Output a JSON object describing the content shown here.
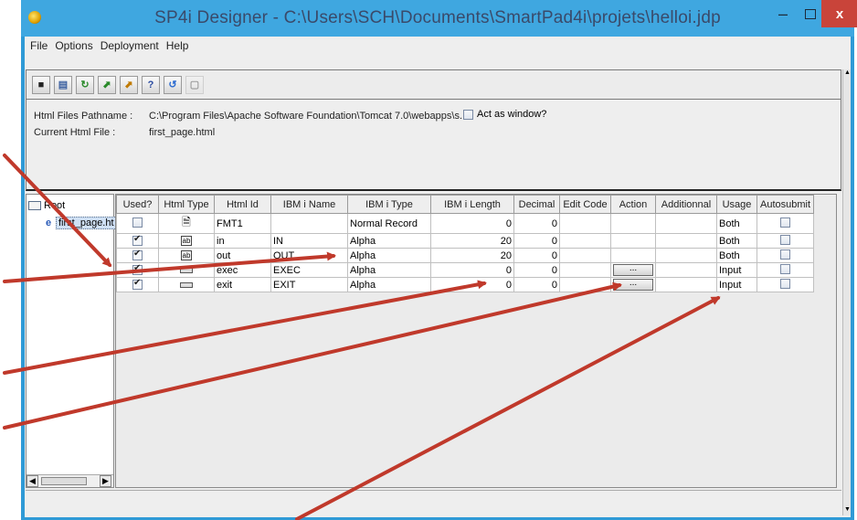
{
  "window": {
    "title": "SP4i Designer - C:\\Users\\SCH\\Documents\\SmartPad4i\\projets\\helloi.jdp",
    "minimize_icon": "minimize-icon",
    "maximize_icon": "maximize-icon",
    "close_label": "x"
  },
  "menu": {
    "items": [
      "File",
      "Options",
      "Deployment",
      "Help"
    ]
  },
  "toolbar": {
    "buttons": [
      {
        "name": "save-icon",
        "glyph": "■"
      },
      {
        "name": "pages-icon",
        "glyph": "▤"
      },
      {
        "name": "refresh-icon",
        "glyph": "↻"
      },
      {
        "name": "export-icon",
        "glyph": "⬈"
      },
      {
        "name": "deploy-icon",
        "glyph": "⬈"
      },
      {
        "name": "help-icon",
        "glyph": "?"
      },
      {
        "name": "reload-icon",
        "glyph": "↺"
      },
      {
        "name": "disabled-icon",
        "glyph": "▢"
      }
    ]
  },
  "info": {
    "pathname_label": "Html Files Pathname :",
    "pathname_value": "C:\\Program Files\\Apache Software Foundation\\Tomcat 7.0\\webapps\\s...",
    "current_label": "Current Html File :",
    "current_value": "first_page.html",
    "act_as_window": "Act as window?"
  },
  "tree": {
    "root": "Root",
    "child": "first_page.ht"
  },
  "table": {
    "headers": [
      "Used?",
      "Html Type",
      "Html Id",
      "IBM i Name",
      "IBM i Type",
      "IBM i Length",
      "Decimal",
      "Edit Code",
      "Action",
      "Additionnal",
      "Usage",
      "Autosubmit"
    ],
    "rows": [
      {
        "used": false,
        "html_type": "form",
        "html_id": "FMT1",
        "ibm_name": "",
        "ibm_type": "Normal Record",
        "length": "0",
        "decimal": "0",
        "edit_code": "",
        "action": "",
        "additional": "",
        "usage": "Both"
      },
      {
        "used": true,
        "html_type": "text",
        "html_id": "in",
        "ibm_name": "IN",
        "ibm_type": "Alpha",
        "length": "20",
        "decimal": "0",
        "edit_code": "",
        "action": "",
        "additional": "",
        "usage": "Both"
      },
      {
        "used": true,
        "html_type": "text",
        "html_id": "out",
        "ibm_name": "OUT",
        "ibm_type": "Alpha",
        "length": "20",
        "decimal": "0",
        "edit_code": "",
        "action": "",
        "additional": "",
        "usage": "Both"
      },
      {
        "used": true,
        "html_type": "button",
        "html_id": "exec",
        "ibm_name": "EXEC",
        "ibm_type": "Alpha",
        "length": "0",
        "decimal": "0",
        "edit_code": "",
        "action": "...",
        "additional": "",
        "usage": "Input"
      },
      {
        "used": true,
        "html_type": "button",
        "html_id": "exit",
        "ibm_name": "EXIT",
        "ibm_type": "Alpha",
        "length": "0",
        "decimal": "0",
        "edit_code": "",
        "action": "...",
        "additional": "",
        "usage": "Input"
      }
    ]
  },
  "colors": {
    "title_bar": "#3fa7e0",
    "close_button": "#c9443a",
    "annotation_arrow": "#c0392b"
  }
}
